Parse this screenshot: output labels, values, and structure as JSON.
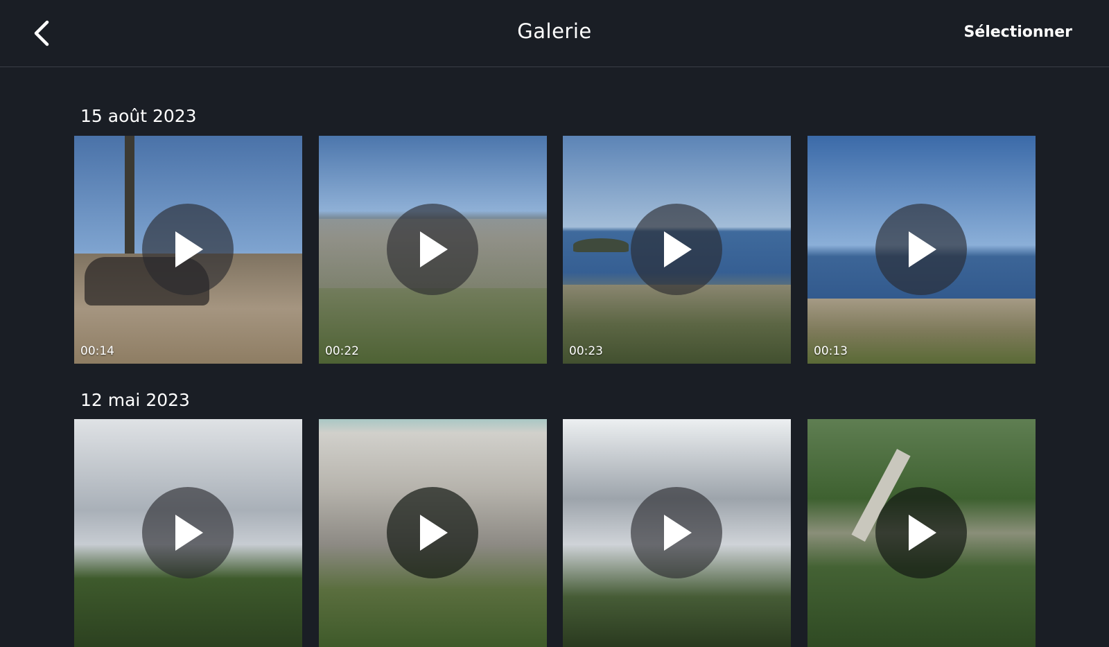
{
  "header": {
    "title": "Galerie",
    "select_label": "Sélectionner",
    "back_icon": "chevron-left-icon"
  },
  "sections": [
    {
      "date": "15 août 2023",
      "items": [
        {
          "type": "video",
          "duration": "00:14"
        },
        {
          "type": "video",
          "duration": "00:22"
        },
        {
          "type": "video",
          "duration": "00:23"
        },
        {
          "type": "video",
          "duration": "00:13"
        }
      ]
    },
    {
      "date": "12 mai 2023",
      "items": [
        {
          "type": "video"
        },
        {
          "type": "video"
        },
        {
          "type": "video"
        },
        {
          "type": "video"
        }
      ]
    }
  ],
  "colors": {
    "background": "#1a1e25",
    "divider": "#3a3f47",
    "text": "#ffffff"
  }
}
